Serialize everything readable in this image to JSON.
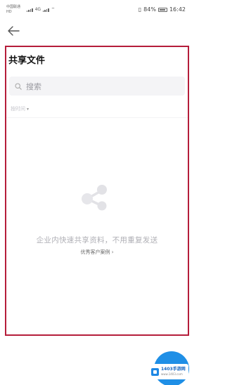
{
  "status_bar": {
    "carrier_top": "中国联通",
    "carrier_bottom": "HD",
    "network": "4G",
    "battery_percent": "84%",
    "time": "16:42"
  },
  "page": {
    "title": "共享文件",
    "back_icon": "arrow-left-icon"
  },
  "search": {
    "placeholder": "搜索"
  },
  "sort": {
    "label": "按时间",
    "arrow": "▾"
  },
  "empty_state": {
    "icon": "share-icon",
    "message": "企业内快速共享资料，不用重复发送",
    "link_text": "优秀客户案例",
    "link_arrow": "›"
  },
  "watermark": {
    "title": "1403手游网",
    "subtitle": "www.1403.com"
  },
  "colors": {
    "highlight_border": "#b51d3a",
    "fab": "#1f8fe6"
  }
}
